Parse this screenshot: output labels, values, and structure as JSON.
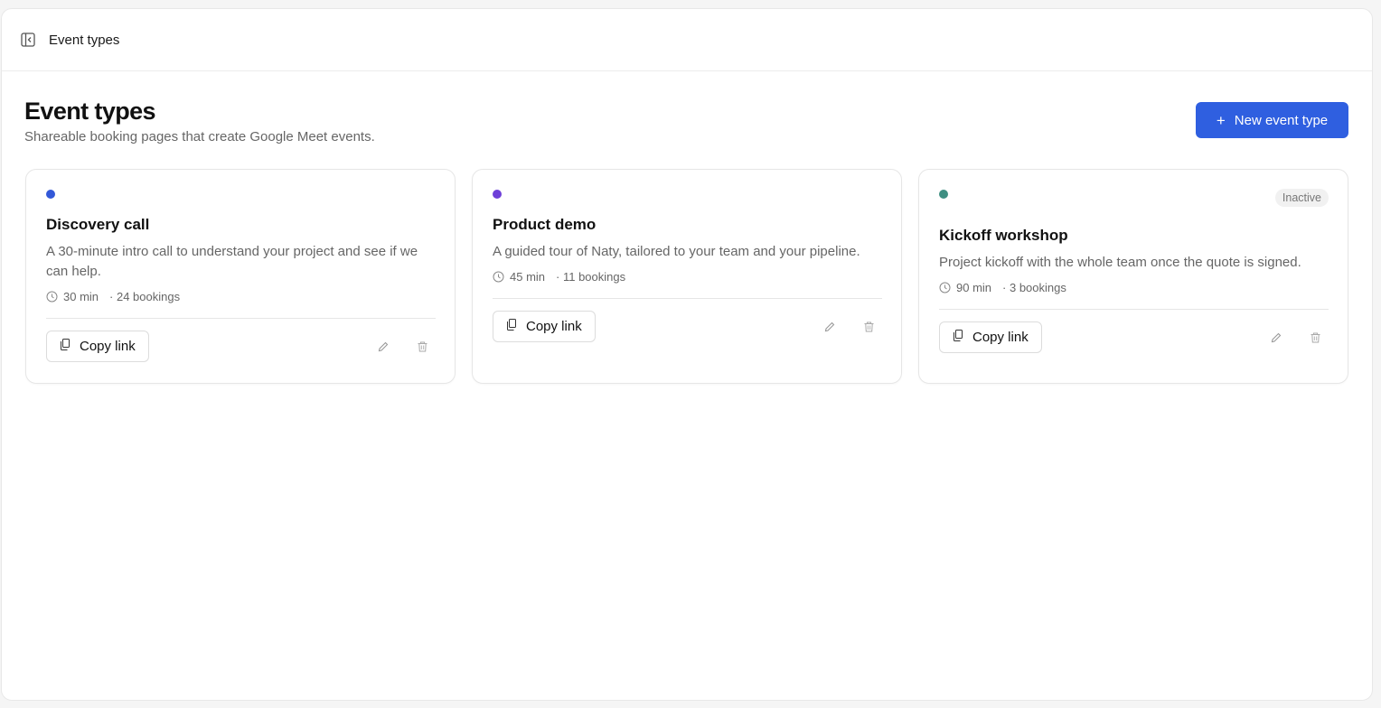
{
  "topbar": {
    "title": "Event types"
  },
  "header": {
    "title": "Event types",
    "subtitle": "Shareable booking pages that create Google Meet events.",
    "new_button_label": "New event type"
  },
  "colors": {
    "accent": "#2f5fe0"
  },
  "event_types": [
    {
      "color": "#3358d8",
      "title": "Discovery call",
      "description": "A 30-minute intro call to understand your project and see if we can help.",
      "duration": "30 min",
      "bookings": "· 24 bookings",
      "status": null,
      "copy_label": "Copy link"
    },
    {
      "color": "#6e3fd8",
      "title": "Product demo",
      "description": "A guided tour of Naty, tailored to your team and your pipeline.",
      "duration": "45 min",
      "bookings": "· 11 bookings",
      "status": null,
      "copy_label": "Copy link"
    },
    {
      "color": "#3f8f82",
      "title": "Kickoff workshop",
      "description": "Project kickoff with the whole team once the quote is signed.",
      "duration": "90 min",
      "bookings": "· 3 bookings",
      "status": "Inactive",
      "copy_label": "Copy link"
    }
  ],
  "icons": {
    "sidebar_toggle": "sidebar-collapse-icon",
    "plus": "plus-icon",
    "clock": "clock-icon",
    "copy": "copy-icon",
    "edit": "pencil-icon",
    "delete": "trash-icon"
  }
}
